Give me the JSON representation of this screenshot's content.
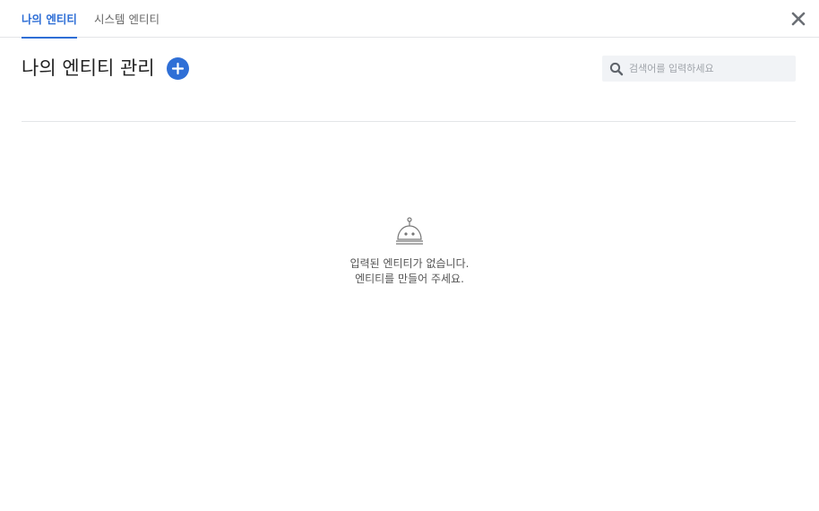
{
  "tabs": [
    {
      "label": "나의 엔티티",
      "active": true
    },
    {
      "label": "시스템 엔티티",
      "active": false
    }
  ],
  "close_icon": "close-icon",
  "header": {
    "title": "나의 엔티티 관리",
    "add_icon": "plus-circle-icon"
  },
  "search": {
    "placeholder": "검색어를 입력하세요",
    "value": "",
    "icon": "search-icon"
  },
  "empty_state": {
    "icon": "robot-icon",
    "line1": "입력된 엔티티가 없습니다.",
    "line2": "엔티티를 만들어 주세요."
  },
  "colors": {
    "accent": "#2f6fd6",
    "divider": "#e3e5e8",
    "search_bg": "#f1f3f6"
  }
}
